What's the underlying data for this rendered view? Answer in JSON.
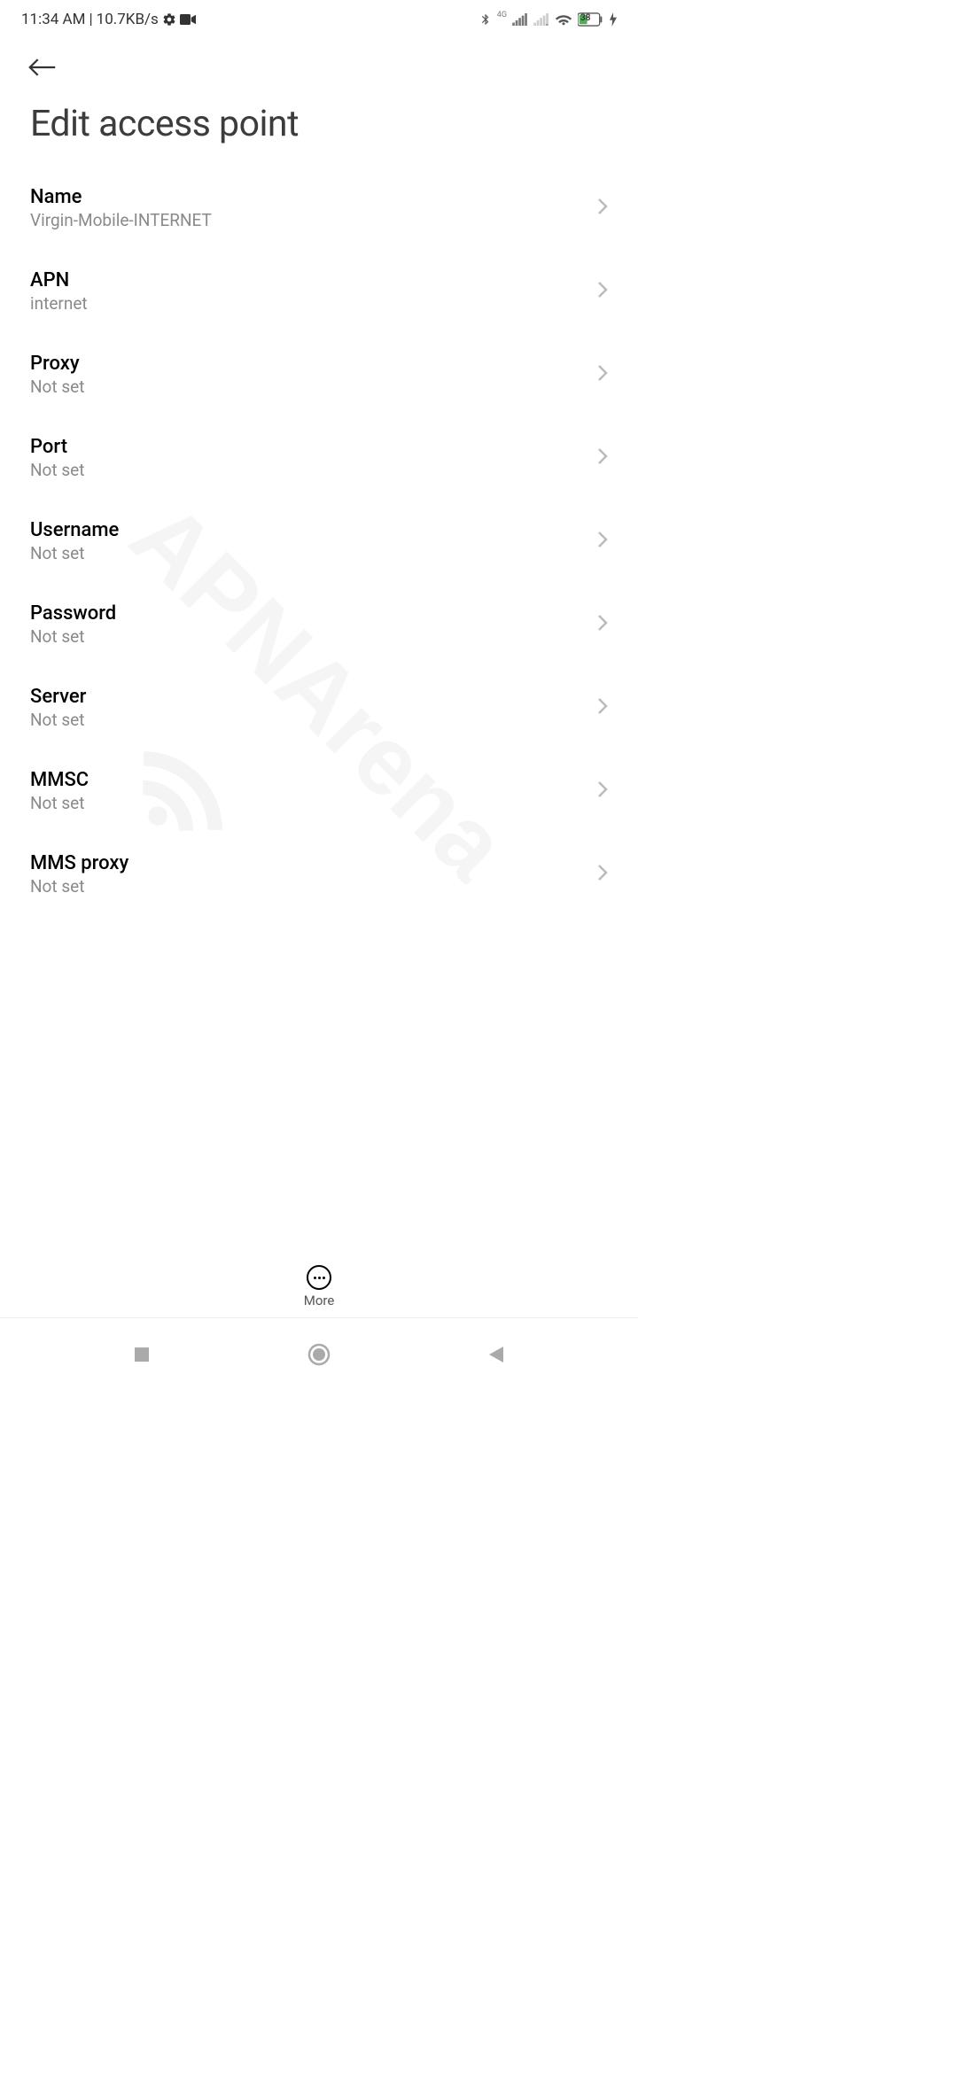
{
  "status_bar": {
    "time": "11:34 AM",
    "separator": "|",
    "data_rate": "10.7KB/s",
    "battery_percent": "38"
  },
  "header": {
    "title": "Edit access point"
  },
  "settings": [
    {
      "label": "Name",
      "value": "Virgin-Mobile-INTERNET"
    },
    {
      "label": "APN",
      "value": "internet"
    },
    {
      "label": "Proxy",
      "value": "Not set"
    },
    {
      "label": "Port",
      "value": "Not set"
    },
    {
      "label": "Username",
      "value": "Not set"
    },
    {
      "label": "Password",
      "value": "Not set"
    },
    {
      "label": "Server",
      "value": "Not set"
    },
    {
      "label": "MMSC",
      "value": "Not set"
    },
    {
      "label": "MMS proxy",
      "value": "Not set"
    }
  ],
  "bottom_action": {
    "label": "More"
  },
  "watermark": "APNArena"
}
